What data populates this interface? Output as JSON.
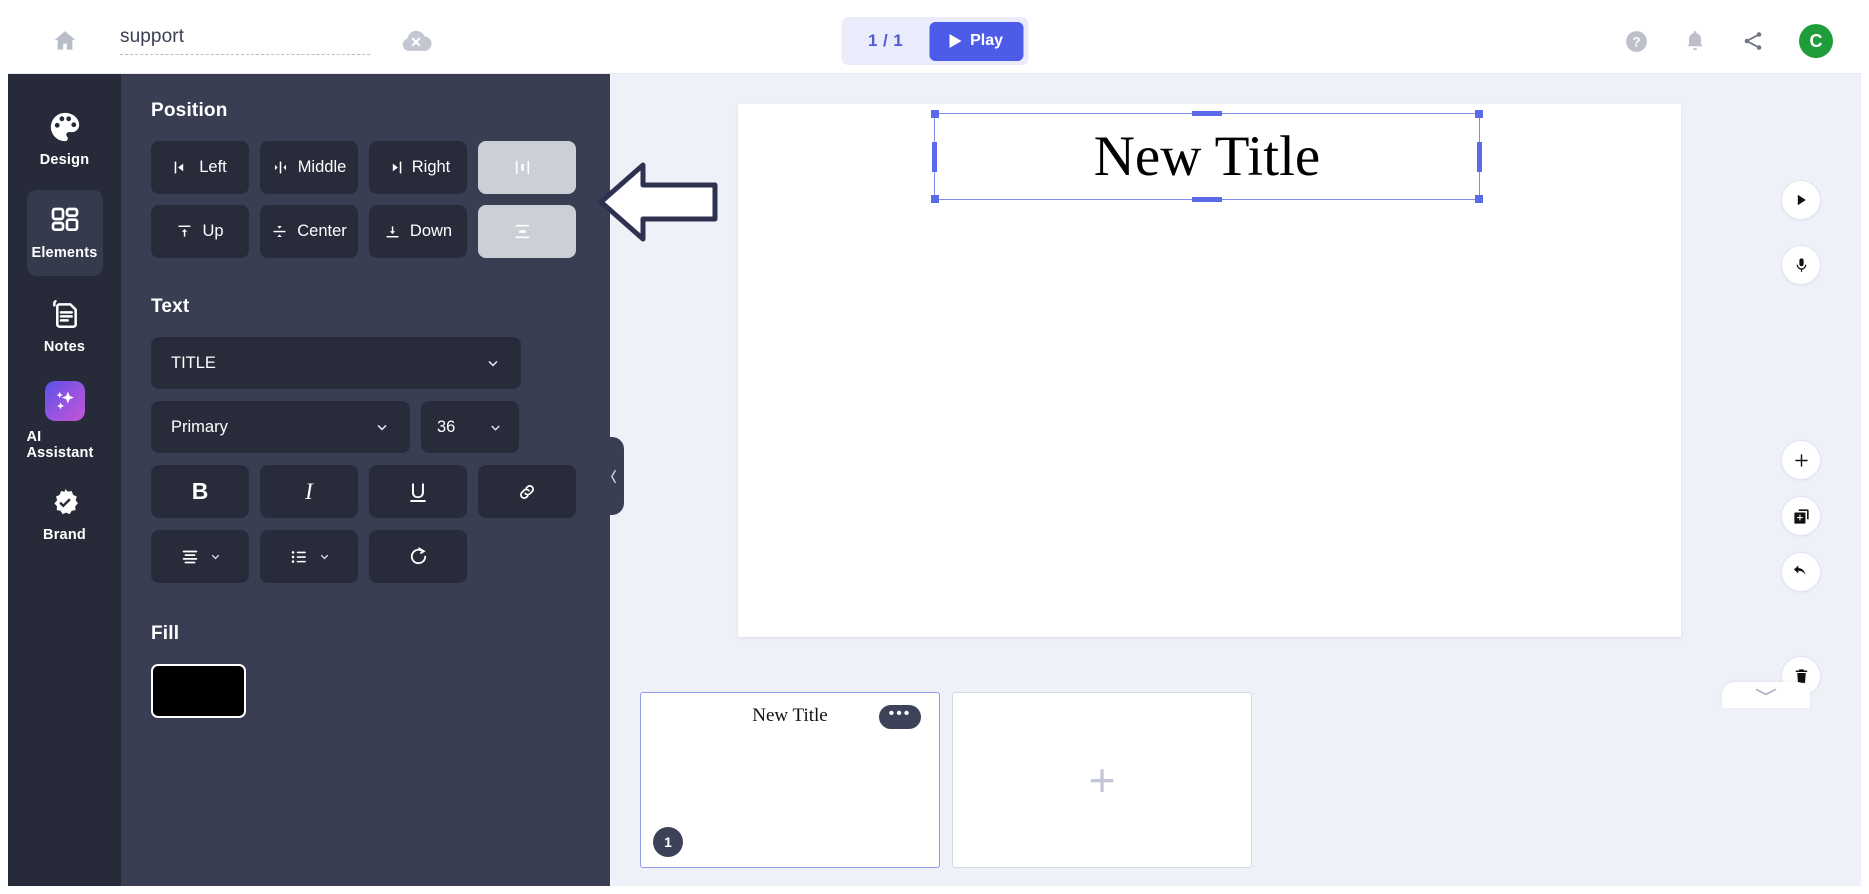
{
  "topbar": {
    "home_icon": "home-icon",
    "project_title": "support",
    "project_title_placeholder": "Untitled",
    "close_icon": "cloud-close-icon",
    "page_count": "1 / 1",
    "play_label": "Play",
    "help_icon": "help-circle-icon",
    "bell_icon": "notification-bell-icon",
    "share_icon": "share-icon",
    "avatar_initial": "C",
    "avatar_color": "#1f9d3a",
    "accent_color": "#4c5ce8"
  },
  "rail": {
    "items": [
      {
        "label": "Design",
        "icon": "palette-icon",
        "active": false
      },
      {
        "label": "Elements",
        "icon": "grid-shapes-icon",
        "active": true
      },
      {
        "label": "Notes",
        "icon": "notes-document-icon",
        "active": false
      },
      {
        "label": "AI Assistant",
        "icon": "sparkles-icon",
        "active": false
      },
      {
        "label": "Brand",
        "icon": "badge-check-icon",
        "active": false
      }
    ]
  },
  "panel": {
    "position": {
      "title": "Position",
      "buttons": [
        {
          "label": "Left",
          "icon": "align-left-icon",
          "style": "dark"
        },
        {
          "label": "Middle",
          "icon": "align-middle-icon",
          "style": "dark"
        },
        {
          "label": "Right",
          "icon": "align-right-icon",
          "style": "dark"
        },
        {
          "label": "",
          "icon": "distribute-horizontal-icon",
          "style": "light"
        },
        {
          "label": "Up",
          "icon": "align-top-icon",
          "style": "dark"
        },
        {
          "label": "Center",
          "icon": "align-center-vertical-icon",
          "style": "dark"
        },
        {
          "label": "Down",
          "icon": "align-bottom-icon",
          "style": "dark"
        },
        {
          "label": "",
          "icon": "distribute-vertical-icon",
          "style": "light"
        }
      ]
    },
    "text": {
      "title": "Text",
      "style_select": "TITLE",
      "color_select": "Primary",
      "size_select": "36",
      "format_buttons": [
        {
          "label": "B",
          "icon": "bold-icon"
        },
        {
          "label": "I",
          "icon": "italic-icon"
        },
        {
          "label": "U",
          "icon": "underline-icon"
        },
        {
          "label": "",
          "icon": "link-icon"
        },
        {
          "label": "",
          "icon": "text-align-icon"
        },
        {
          "label": "",
          "icon": "bullet-list-icon"
        },
        {
          "label": "",
          "icon": "rotate-icon"
        }
      ]
    },
    "fill": {
      "title": "Fill",
      "swatch_color": "#000000"
    },
    "collapse_icon": "chevron-left-icon"
  },
  "canvas": {
    "slide_text": "New Title",
    "selection_color": "#5b6ae8",
    "right_tools": [
      {
        "icon": "play-circle-icon"
      },
      {
        "icon": "microphone-icon"
      },
      {
        "icon": "add-icon"
      },
      {
        "icon": "duplicate-icon"
      },
      {
        "icon": "undo-icon"
      },
      {
        "icon": "trash-icon"
      }
    ],
    "pull_tab_icon": "chevron-down-icon"
  },
  "tray": {
    "slides": [
      {
        "title": "New Title",
        "badge": "1",
        "more_label": "•••",
        "selected": true
      },
      {
        "title": "",
        "add_icon": "plus-icon",
        "selected": false
      }
    ]
  },
  "annotation": {
    "arrow_icon": "pointer-arrow-left-icon"
  }
}
